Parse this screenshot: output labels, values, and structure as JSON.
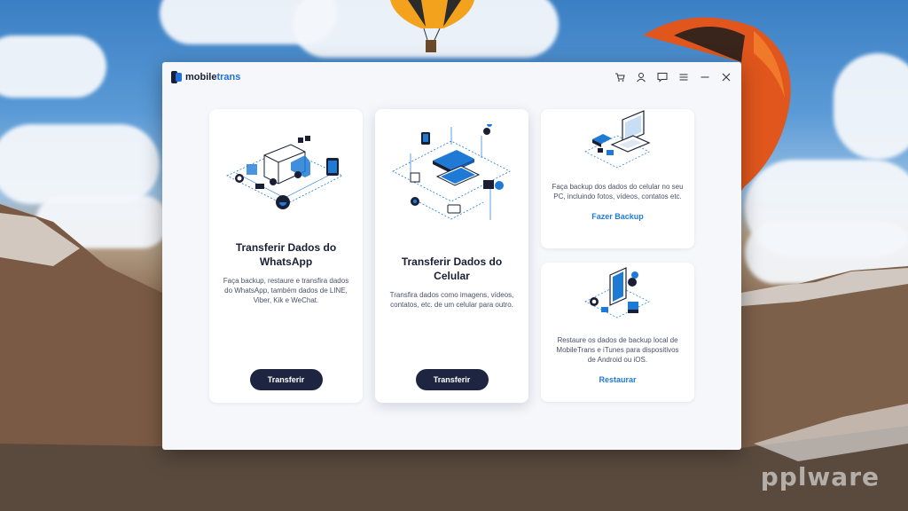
{
  "watermark": "pplware",
  "app": {
    "brand_prefix": "mobile",
    "brand_suffix": "trans"
  },
  "titlebar": {
    "icons": [
      "cart-icon",
      "user-icon",
      "feedback-icon",
      "menu-icon",
      "minimize-icon",
      "close-icon"
    ]
  },
  "cards": {
    "whatsapp": {
      "title": "Transferir Dados do WhatsApp",
      "description": "Faça backup, restaure e transfira dados do WhatsApp, também dados de LINE, Viber, Kik e WeChat.",
      "button": "Transferir"
    },
    "phone": {
      "title": "Transferir Dados do Celular",
      "description": "Transfira dados como imagens, vídeos, contatos, etc. de um celular para outro.",
      "button": "Transferir"
    },
    "backup": {
      "description": "Faça backup dos dados do celular no seu PC, incluindo fotos, vídeos, contatos etc.",
      "link": "Fazer Backup"
    },
    "restore": {
      "description": "Restaure os dados de backup local de MobileTrans e iTunes para dispositivos de Android ou iOS.",
      "link": "Restaurar"
    }
  },
  "colors": {
    "accent": "#1f7ad6",
    "button_dark": "#1e2541",
    "window_bg": "#f5f7fa"
  }
}
